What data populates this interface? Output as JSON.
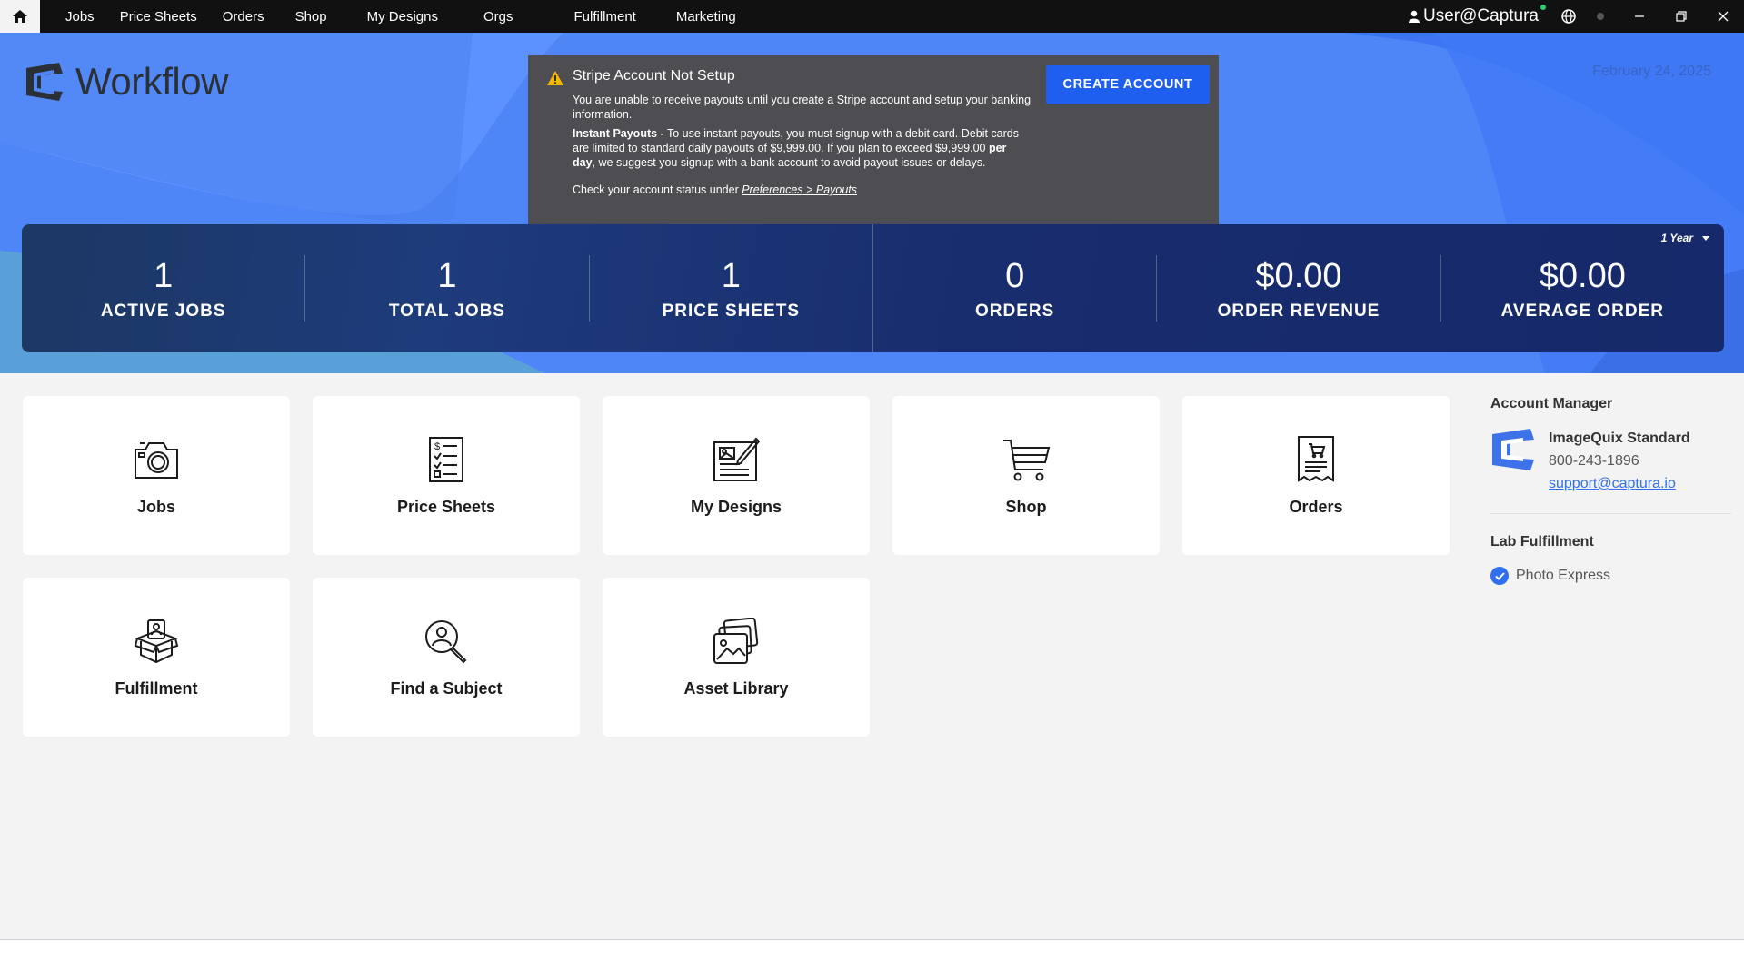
{
  "nav": {
    "items": [
      "Jobs",
      "Price Sheets",
      "Orders",
      "Shop",
      "My Designs",
      "Orgs",
      "Fulfillment",
      "Marketing"
    ],
    "user": "User@Captura"
  },
  "hero": {
    "logo_text": "Workflow",
    "date": "February 24, 2025",
    "alert": {
      "title": "Stripe Account Not Setup",
      "line1": "You are unable to receive payouts until you create a Stripe account and setup your banking information.",
      "instant_label": "Instant Payouts -",
      "instant_text1": " To use instant payouts, you must signup with a debit card. Debit cards are limited to standard daily payouts of $9,999.00. If you plan to exceed $9,999.00 ",
      "instant_bold": "per day",
      "instant_text2": ", we suggest you signup with a bank account to avoid payout issues or delays.",
      "status_text": "Check your account status under ",
      "status_link": "Preferences > Payouts",
      "button": "CREATE ACCOUNT"
    },
    "period": "1 Year",
    "stats": [
      {
        "value": "1",
        "label": "ACTIVE JOBS"
      },
      {
        "value": "1",
        "label": "TOTAL JOBS"
      },
      {
        "value": "1",
        "label": "PRICE SHEETS"
      },
      {
        "value": "0",
        "label": "ORDERS"
      },
      {
        "value": "$0.00",
        "label": "ORDER REVENUE"
      },
      {
        "value": "$0.00",
        "label": "AVERAGE ORDER"
      }
    ]
  },
  "tiles": [
    {
      "label": "Jobs",
      "icon": "camera-icon"
    },
    {
      "label": "Price Sheets",
      "icon": "price-sheet-icon"
    },
    {
      "label": "My Designs",
      "icon": "design-icon"
    },
    {
      "label": "Shop",
      "icon": "cart-icon"
    },
    {
      "label": "Orders",
      "icon": "receipt-icon"
    },
    {
      "label": "Fulfillment",
      "icon": "box-icon"
    },
    {
      "label": "Find a Subject",
      "icon": "person-search-icon"
    },
    {
      "label": "Asset Library",
      "icon": "image-stack-icon"
    }
  ],
  "sidebar": {
    "account_heading": "Account Manager",
    "account_name": "ImageQuix Standard",
    "phone": "800-243-1896",
    "email": "support@captura.io",
    "lab_heading": "Lab Fulfillment",
    "lab_name": "Photo Express"
  },
  "colors": {
    "accent": "#1f5ff0",
    "hero_blue": "#4f86f7",
    "stats_bg": "#1e3b7c",
    "alert_bg": "#4d4d52"
  }
}
